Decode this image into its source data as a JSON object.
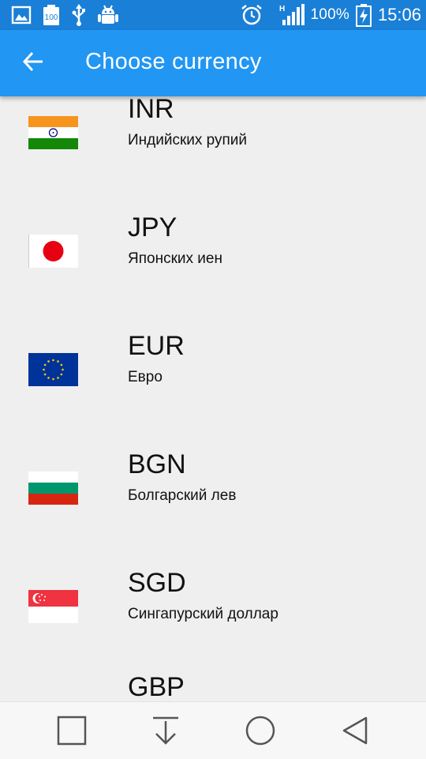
{
  "status_bar": {
    "left_icons": [
      "image-icon",
      "battery-100-icon",
      "usb-icon",
      "android-debug-icon"
    ],
    "battery_badge": "100",
    "network_label": "H",
    "battery_percent": "100%",
    "time": "15:06"
  },
  "app_bar": {
    "title": "Choose currency",
    "back_icon": "arrow-left-icon"
  },
  "currencies": [
    {
      "code": "INR",
      "name": "Индийских рупий",
      "flag": "india-flag"
    },
    {
      "code": "JPY",
      "name": "Японских иен",
      "flag": "japan-flag"
    },
    {
      "code": "EUR",
      "name": "Евро",
      "flag": "eu-flag"
    },
    {
      "code": "BGN",
      "name": "Болгарский лев",
      "flag": "bulgaria-flag"
    },
    {
      "code": "SGD",
      "name": "Сингапурский доллар",
      "flag": "singapore-flag"
    },
    {
      "code": "GBP",
      "name": "",
      "flag": "uk-flag"
    }
  ],
  "nav_bar": {
    "icons": [
      "recent-apps-icon",
      "download-icon",
      "home-icon",
      "back-icon"
    ]
  },
  "colors": {
    "status_bar": "#1a7fd6",
    "app_bar": "#2196f3",
    "list_background": "#efefef"
  }
}
